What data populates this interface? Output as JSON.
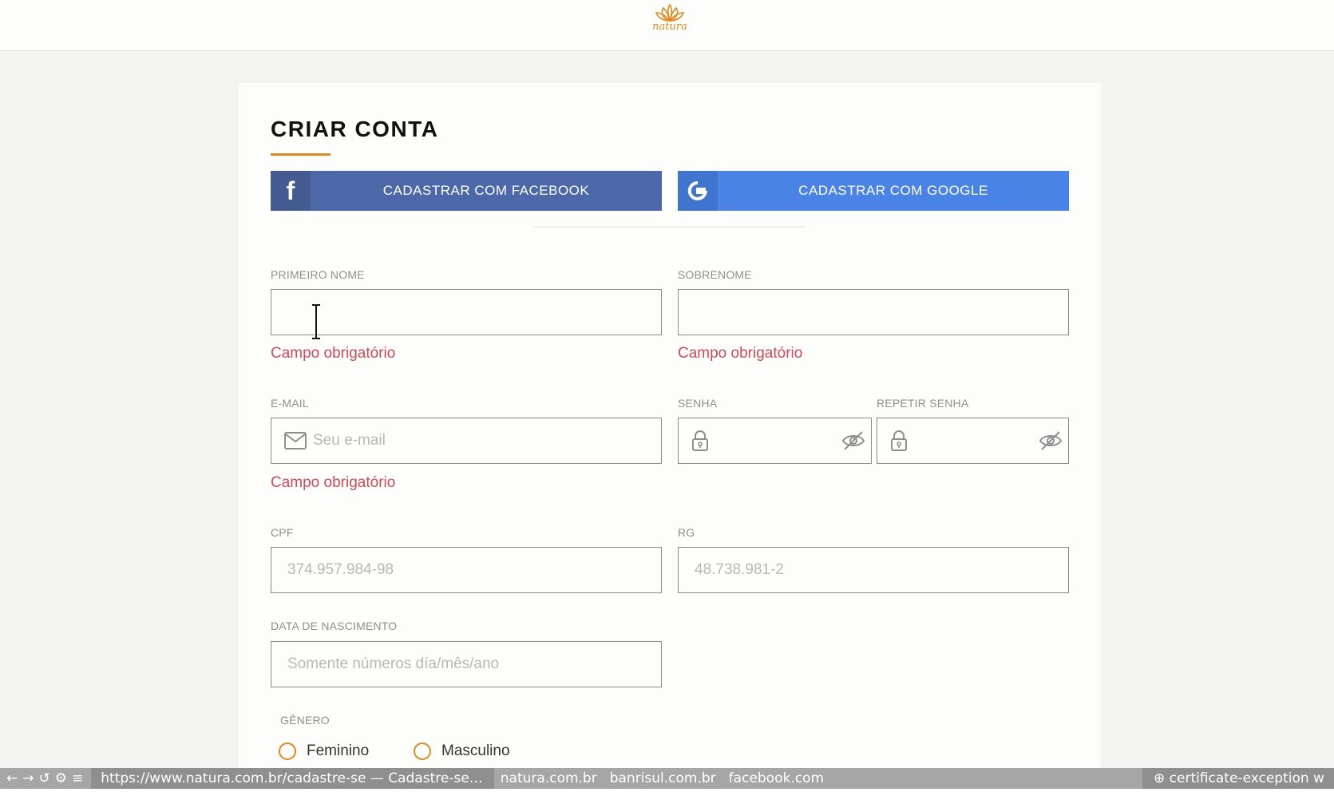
{
  "header": {
    "logo_text": "natura",
    "logo_color": "#e08a1e"
  },
  "form": {
    "title": "CRIAR CONTA",
    "facebook_button": {
      "icon": "facebook-icon",
      "label": "CADASTRAR COM FACEBOOK"
    },
    "google_button": {
      "icon": "google-icon",
      "label": "CADASTRAR COM GOOGLE"
    },
    "first_name": {
      "label": "PRIMEIRO NOME",
      "value": "",
      "error": "Campo obrigatório"
    },
    "last_name": {
      "label": "SOBRENOME",
      "value": "",
      "error": "Campo obrigatório"
    },
    "email": {
      "label": "E-MAIL",
      "placeholder": "Seu e-mail",
      "icon": "envelope-icon",
      "error": "Campo obrigatório"
    },
    "password": {
      "label": "SENHA",
      "value": "",
      "icon": "lock-icon",
      "toggle_icon": "eye-slash-icon"
    },
    "repeat_password": {
      "label": "REPETIR SENHA",
      "value": "",
      "icon": "lock-icon",
      "toggle_icon": "eye-slash-icon"
    },
    "cpf": {
      "label": "CPF",
      "placeholder": "374.957.984-98"
    },
    "rg": {
      "label": "RG",
      "placeholder": "48.738.981-2"
    },
    "birth_date": {
      "label": "DATA DE NASCIMENTO",
      "placeholder": "Somente números día/mês/ano"
    },
    "gender": {
      "label": "GÊNERO",
      "options": [
        "Feminino",
        "Masculino"
      ]
    }
  },
  "colors": {
    "accent": "#e08a1e",
    "facebook": "#4d68a8",
    "google": "#4a83e6",
    "error": "#d04a5a"
  },
  "statusbar": {
    "nav": [
      "←",
      "→",
      "↺",
      "⚙",
      "≡"
    ],
    "url": "https://www.natura.com.br/cadastre-se — Cadastre-se…",
    "tabs": [
      "natura.com.br",
      "banrisul.com.br",
      "facebook.com"
    ],
    "right": "⊕ certificate-exception  w"
  }
}
